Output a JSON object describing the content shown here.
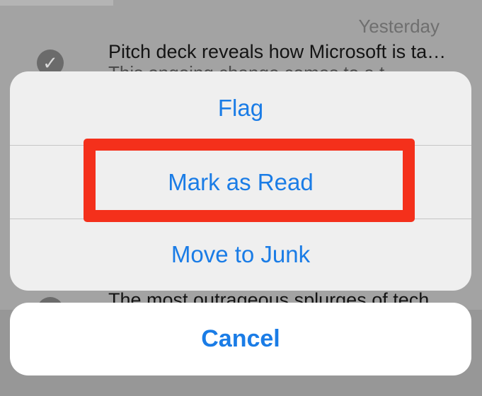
{
  "mail_list": {
    "date": "Yesterday",
    "item1_subject": "Pitch deck reveals how Microsoft is ta…",
    "item1_preview": "This ongoing change comes to a t",
    "item2_subject": "The most outrageous splurges of tech"
  },
  "action_sheet": {
    "flag_label": "Flag",
    "mark_read_label": "Mark as Read",
    "junk_label": "Move to Junk",
    "cancel_label": "Cancel"
  },
  "colors": {
    "action_blue": "#1a7ce6",
    "highlight_red": "#f4301b"
  }
}
